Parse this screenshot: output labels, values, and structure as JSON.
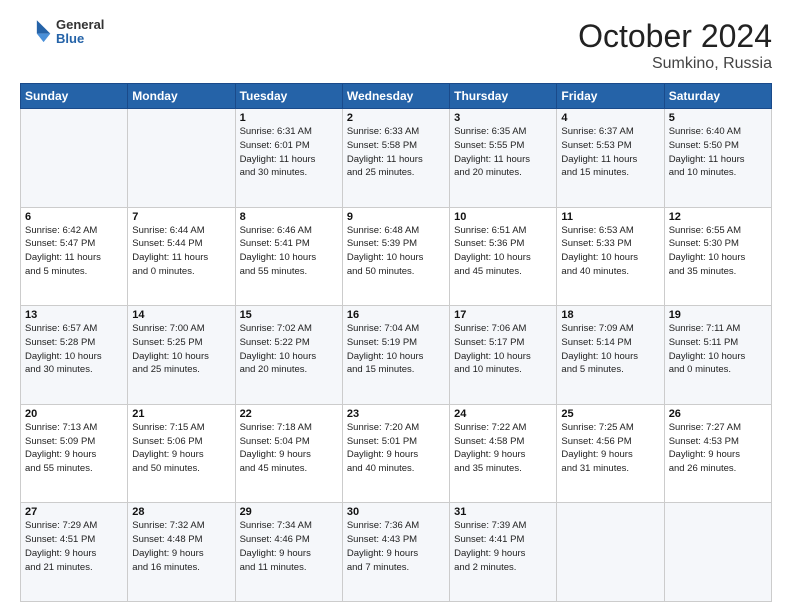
{
  "header": {
    "logo": {
      "general": "General",
      "blue": "Blue"
    },
    "month": "October 2024",
    "location": "Sumkino, Russia"
  },
  "days_of_week": [
    "Sunday",
    "Monday",
    "Tuesday",
    "Wednesday",
    "Thursday",
    "Friday",
    "Saturday"
  ],
  "weeks": [
    [
      {
        "day": "",
        "info": ""
      },
      {
        "day": "",
        "info": ""
      },
      {
        "day": "1",
        "info": "Sunrise: 6:31 AM\nSunset: 6:01 PM\nDaylight: 11 hours\nand 30 minutes."
      },
      {
        "day": "2",
        "info": "Sunrise: 6:33 AM\nSunset: 5:58 PM\nDaylight: 11 hours\nand 25 minutes."
      },
      {
        "day": "3",
        "info": "Sunrise: 6:35 AM\nSunset: 5:55 PM\nDaylight: 11 hours\nand 20 minutes."
      },
      {
        "day": "4",
        "info": "Sunrise: 6:37 AM\nSunset: 5:53 PM\nDaylight: 11 hours\nand 15 minutes."
      },
      {
        "day": "5",
        "info": "Sunrise: 6:40 AM\nSunset: 5:50 PM\nDaylight: 11 hours\nand 10 minutes."
      }
    ],
    [
      {
        "day": "6",
        "info": "Sunrise: 6:42 AM\nSunset: 5:47 PM\nDaylight: 11 hours\nand 5 minutes."
      },
      {
        "day": "7",
        "info": "Sunrise: 6:44 AM\nSunset: 5:44 PM\nDaylight: 11 hours\nand 0 minutes."
      },
      {
        "day": "8",
        "info": "Sunrise: 6:46 AM\nSunset: 5:41 PM\nDaylight: 10 hours\nand 55 minutes."
      },
      {
        "day": "9",
        "info": "Sunrise: 6:48 AM\nSunset: 5:39 PM\nDaylight: 10 hours\nand 50 minutes."
      },
      {
        "day": "10",
        "info": "Sunrise: 6:51 AM\nSunset: 5:36 PM\nDaylight: 10 hours\nand 45 minutes."
      },
      {
        "day": "11",
        "info": "Sunrise: 6:53 AM\nSunset: 5:33 PM\nDaylight: 10 hours\nand 40 minutes."
      },
      {
        "day": "12",
        "info": "Sunrise: 6:55 AM\nSunset: 5:30 PM\nDaylight: 10 hours\nand 35 minutes."
      }
    ],
    [
      {
        "day": "13",
        "info": "Sunrise: 6:57 AM\nSunset: 5:28 PM\nDaylight: 10 hours\nand 30 minutes."
      },
      {
        "day": "14",
        "info": "Sunrise: 7:00 AM\nSunset: 5:25 PM\nDaylight: 10 hours\nand 25 minutes."
      },
      {
        "day": "15",
        "info": "Sunrise: 7:02 AM\nSunset: 5:22 PM\nDaylight: 10 hours\nand 20 minutes."
      },
      {
        "day": "16",
        "info": "Sunrise: 7:04 AM\nSunset: 5:19 PM\nDaylight: 10 hours\nand 15 minutes."
      },
      {
        "day": "17",
        "info": "Sunrise: 7:06 AM\nSunset: 5:17 PM\nDaylight: 10 hours\nand 10 minutes."
      },
      {
        "day": "18",
        "info": "Sunrise: 7:09 AM\nSunset: 5:14 PM\nDaylight: 10 hours\nand 5 minutes."
      },
      {
        "day": "19",
        "info": "Sunrise: 7:11 AM\nSunset: 5:11 PM\nDaylight: 10 hours\nand 0 minutes."
      }
    ],
    [
      {
        "day": "20",
        "info": "Sunrise: 7:13 AM\nSunset: 5:09 PM\nDaylight: 9 hours\nand 55 minutes."
      },
      {
        "day": "21",
        "info": "Sunrise: 7:15 AM\nSunset: 5:06 PM\nDaylight: 9 hours\nand 50 minutes."
      },
      {
        "day": "22",
        "info": "Sunrise: 7:18 AM\nSunset: 5:04 PM\nDaylight: 9 hours\nand 45 minutes."
      },
      {
        "day": "23",
        "info": "Sunrise: 7:20 AM\nSunset: 5:01 PM\nDaylight: 9 hours\nand 40 minutes."
      },
      {
        "day": "24",
        "info": "Sunrise: 7:22 AM\nSunset: 4:58 PM\nDaylight: 9 hours\nand 35 minutes."
      },
      {
        "day": "25",
        "info": "Sunrise: 7:25 AM\nSunset: 4:56 PM\nDaylight: 9 hours\nand 31 minutes."
      },
      {
        "day": "26",
        "info": "Sunrise: 7:27 AM\nSunset: 4:53 PM\nDaylight: 9 hours\nand 26 minutes."
      }
    ],
    [
      {
        "day": "27",
        "info": "Sunrise: 7:29 AM\nSunset: 4:51 PM\nDaylight: 9 hours\nand 21 minutes."
      },
      {
        "day": "28",
        "info": "Sunrise: 7:32 AM\nSunset: 4:48 PM\nDaylight: 9 hours\nand 16 minutes."
      },
      {
        "day": "29",
        "info": "Sunrise: 7:34 AM\nSunset: 4:46 PM\nDaylight: 9 hours\nand 11 minutes."
      },
      {
        "day": "30",
        "info": "Sunrise: 7:36 AM\nSunset: 4:43 PM\nDaylight: 9 hours\nand 7 minutes."
      },
      {
        "day": "31",
        "info": "Sunrise: 7:39 AM\nSunset: 4:41 PM\nDaylight: 9 hours\nand 2 minutes."
      },
      {
        "day": "",
        "info": ""
      },
      {
        "day": "",
        "info": ""
      }
    ]
  ]
}
